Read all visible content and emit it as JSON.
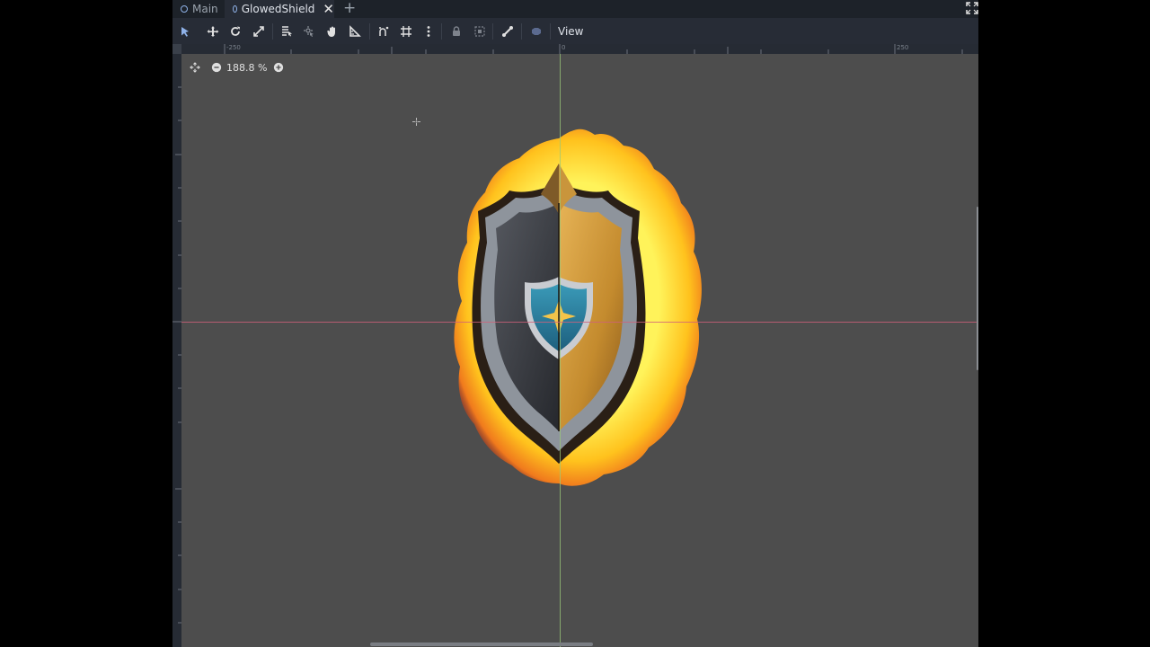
{
  "tabs": [
    {
      "label": "Main",
      "active": false
    },
    {
      "label": "GlowedShield",
      "active": true
    }
  ],
  "toolbar": {
    "view_label": "View",
    "tools": [
      "select-icon",
      "move-icon",
      "rotate-icon",
      "scale-icon",
      "list-select-icon",
      "pivot-icon",
      "pan-icon",
      "ruler-icon",
      "smart-snap-icon",
      "grid-snap-icon",
      "snap-options-icon",
      "lock-icon",
      "group-icon",
      "skeleton-icon",
      "camera-override-icon"
    ]
  },
  "rulers": {
    "top_labels": [
      "-250",
      "0",
      "250"
    ]
  },
  "zoom": {
    "level": "188.8 %"
  },
  "colors": {
    "accent": "#8fb2e8",
    "x_axis": "#d0607a",
    "y_axis": "#9bc87a",
    "viewport_bg": "#4d4d4d"
  }
}
